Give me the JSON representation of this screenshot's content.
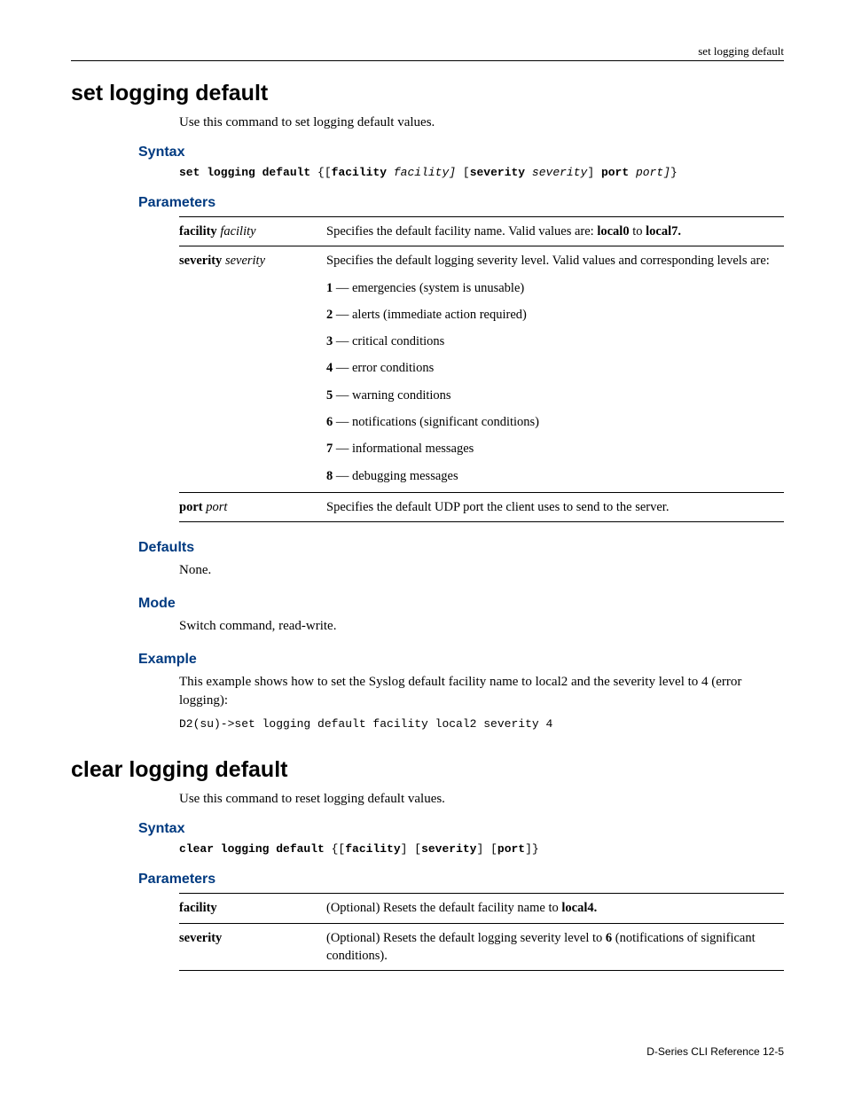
{
  "header": {
    "running_title": "set logging default"
  },
  "section1": {
    "title": "set logging default",
    "intro": "Use this command to set logging default values.",
    "syntax_heading": "Syntax",
    "syntax_cmd_bold1": "set logging default",
    "syntax_open": " {[",
    "syntax_kw1": "facility",
    "syntax_arg1": " facility]",
    "syntax_mid1": " [",
    "syntax_kw2": "severity",
    "syntax_arg2": " severity",
    "syntax_mid2": "] ",
    "syntax_kw3": "port",
    "syntax_arg3": " port]",
    "syntax_close": "}",
    "parameters_heading": "Parameters",
    "params": {
      "facility_label_bold": "facility",
      "facility_label_ital": " facility",
      "facility_desc_pre": "Specifies the default facility name. Valid values are: ",
      "facility_desc_b1": "local0",
      "facility_desc_mid": " to ",
      "facility_desc_b2": "local7.",
      "severity_label_bold": "severity",
      "severity_label_ital": " severity",
      "severity_desc_intro": "Specifies the default logging severity level. Valid values and corresponding levels are:",
      "levels": [
        {
          "num": "1",
          "text": " — emergencies (system is unusable)"
        },
        {
          "num": "2",
          "text": " — alerts (immediate action required)"
        },
        {
          "num": "3",
          "text": " — critical conditions"
        },
        {
          "num": "4",
          "text": " — error conditions"
        },
        {
          "num": "5",
          "text": " — warning conditions"
        },
        {
          "num": "6",
          "text": " — notifications (significant conditions)"
        },
        {
          "num": "7",
          "text": " — informational messages"
        },
        {
          "num": "8",
          "text": " — debugging messages"
        }
      ],
      "port_label_bold": "port",
      "port_label_ital": " port",
      "port_desc": "Specifies the default UDP port the client uses to send to the server."
    },
    "defaults_heading": "Defaults",
    "defaults_text": "None.",
    "mode_heading": "Mode",
    "mode_text": "Switch command, read-write.",
    "example_heading": "Example",
    "example_text": "This example shows how to set the Syslog default facility name to local2 and the severity level to 4 (error logging):",
    "example_code": "D2(su)->set logging default facility local2 severity 4"
  },
  "section2": {
    "title": "clear logging default",
    "intro": "Use this command to reset logging default values.",
    "syntax_heading": "Syntax",
    "syntax_cmd_bold1": "clear logging default",
    "syntax_open": " {[",
    "syntax_kw1": "facility",
    "syntax_mid1": "] [",
    "syntax_kw2": "severity",
    "syntax_mid2": "] [",
    "syntax_kw3": "port",
    "syntax_close": "]}",
    "parameters_heading": "Parameters",
    "params": {
      "facility_label": "facility",
      "facility_desc_pre": "(Optional) Resets the default facility name to ",
      "facility_desc_b": "local4.",
      "severity_label": "severity",
      "severity_desc_pre": "(Optional) Resets the default logging severity level to ",
      "severity_desc_b": "6",
      "severity_desc_post": " (notifications of significant conditions)."
    }
  },
  "footer": {
    "text": "D-Series CLI Reference   12-5"
  }
}
